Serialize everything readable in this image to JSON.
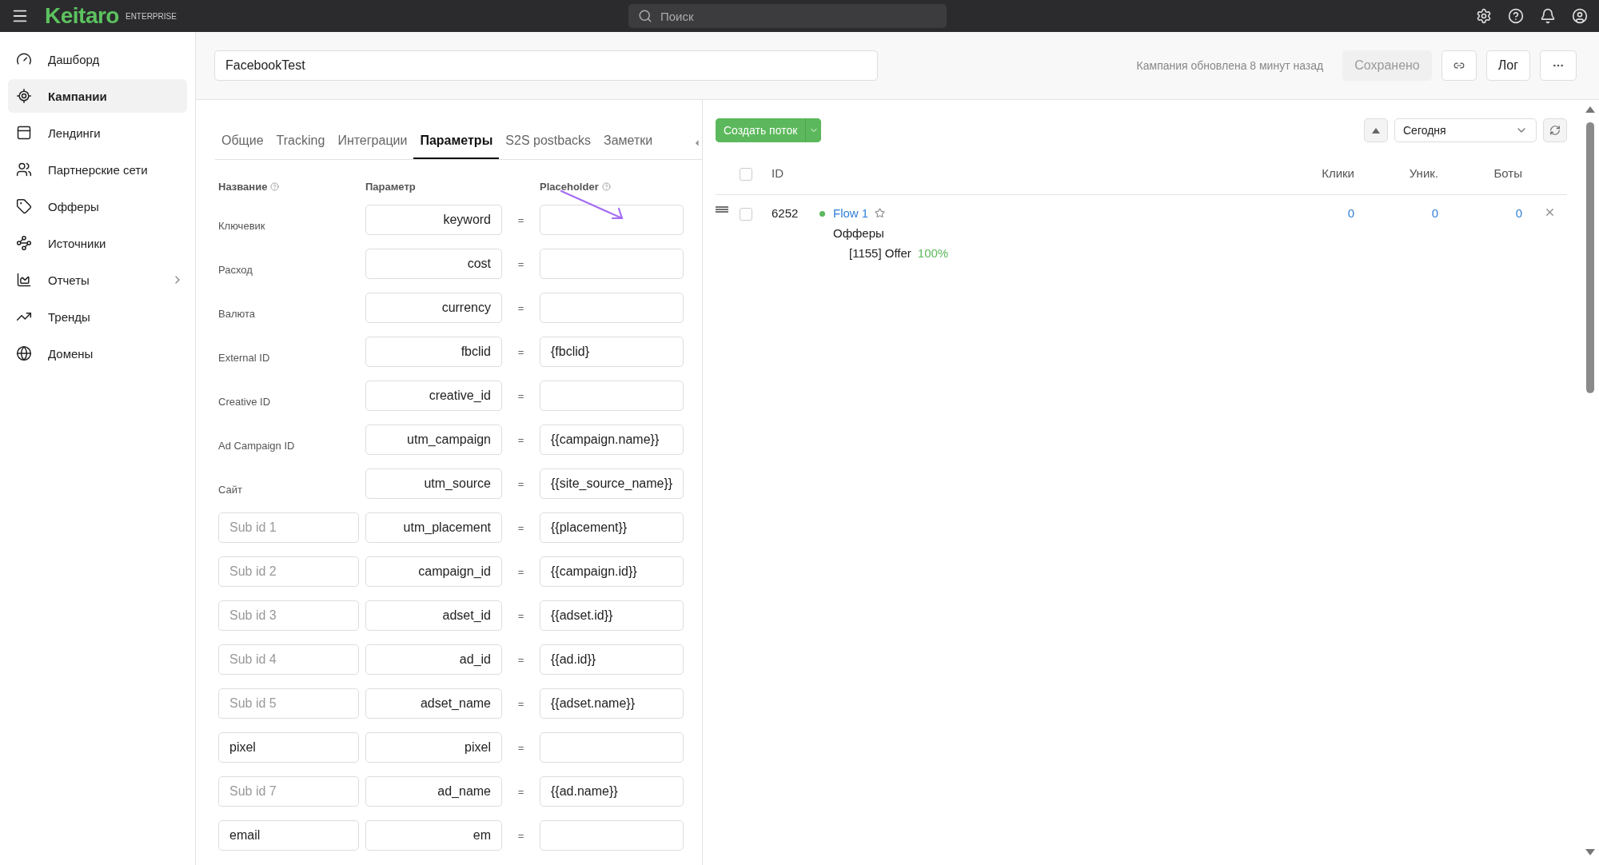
{
  "topbar": {
    "logo": "Keitaro",
    "edition": "ENTERPRISE",
    "search": {
      "placeholder": "Поиск"
    }
  },
  "sidebar": {
    "items": [
      {
        "label": "Дашборд",
        "selected": false,
        "has_submenu": false
      },
      {
        "label": "Кампании",
        "selected": true,
        "has_submenu": false
      },
      {
        "label": "Лендинги",
        "selected": false,
        "has_submenu": false
      },
      {
        "label": "Партнерские сети",
        "selected": false,
        "has_submenu": false
      },
      {
        "label": "Офферы",
        "selected": false,
        "has_submenu": false
      },
      {
        "label": "Источники",
        "selected": false,
        "has_submenu": false
      },
      {
        "label": "Отчеты",
        "selected": false,
        "has_submenu": true
      },
      {
        "label": "Тренды",
        "selected": false,
        "has_submenu": false
      },
      {
        "label": "Домены",
        "selected": false,
        "has_submenu": false
      }
    ]
  },
  "header": {
    "campaign_name": "FacebookTest",
    "updated": "Кампания обновлена 8 минут назад",
    "save_button": {
      "label": "Сохранено",
      "disabled": true
    },
    "log_button": "Лог"
  },
  "tabs": [
    {
      "label": "Общие",
      "selected": false
    },
    {
      "label": "Tracking",
      "selected": false
    },
    {
      "label": "Интеграции",
      "selected": false
    },
    {
      "label": "Параметры",
      "selected": true
    },
    {
      "label": "S2S postbacks",
      "selected": false
    },
    {
      "label": "Заметки",
      "selected": false
    }
  ],
  "parameters": {
    "columns": [
      "Название",
      "Параметр",
      "Placeholder"
    ],
    "rows": [
      {
        "kind": "label",
        "name": "Ключевик",
        "parameter": "keyword",
        "separator": "=",
        "value": ""
      },
      {
        "kind": "label",
        "name": "Расход",
        "parameter": "cost",
        "separator": "=",
        "value": ""
      },
      {
        "kind": "label",
        "name": "Валюта",
        "parameter": "currency",
        "separator": "=",
        "value": ""
      },
      {
        "kind": "label",
        "name": "External ID",
        "parameter": "fbclid",
        "separator": "=",
        "value": "{fbclid}"
      },
      {
        "kind": "label",
        "name": "Creative ID",
        "parameter": "creative_id",
        "separator": "=",
        "value": ""
      },
      {
        "kind": "label",
        "name": "Ad Campaign ID",
        "parameter": "utm_campaign",
        "separator": "=",
        "value": "{{campaign.name}}"
      },
      {
        "kind": "label",
        "name": "Сайт",
        "parameter": "utm_source",
        "separator": "=",
        "value": "{{site_source_name}}"
      },
      {
        "kind": "field",
        "name_hint": "Sub id 1",
        "parameter": "utm_placement",
        "separator": "=",
        "value": "{{placement}}"
      },
      {
        "kind": "field",
        "name_hint": "Sub id 2",
        "parameter": "campaign_id",
        "separator": "=",
        "value": "{{campaign.id}}"
      },
      {
        "kind": "field",
        "name_hint": "Sub id 3",
        "parameter": "adset_id",
        "separator": "=",
        "value": "{{adset.id}}"
      },
      {
        "kind": "field",
        "name_hint": "Sub id 4",
        "parameter": "ad_id",
        "separator": "=",
        "value": "{{ad.id}}"
      },
      {
        "kind": "field",
        "name_hint": "Sub id 5",
        "parameter": "adset_name",
        "separator": "=",
        "value": "{{adset.name}}"
      },
      {
        "kind": "field",
        "name": "pixel",
        "parameter": "pixel",
        "separator": "=",
        "value": ""
      },
      {
        "kind": "field",
        "name_hint": "Sub id 7",
        "parameter": "ad_name",
        "separator": "=",
        "value": "{{ad.name}}"
      },
      {
        "kind": "field",
        "name": "email",
        "parameter": "em",
        "separator": "=",
        "value": ""
      }
    ]
  },
  "flows": {
    "create_button": "Создать поток",
    "period": "Сегодня",
    "all_checked": false,
    "columns": [
      "ID",
      "Клики",
      "Уник.",
      "Боты"
    ],
    "rows": [
      {
        "id": "6252",
        "name": "Flow 1",
        "color": "#5cb85c",
        "checked": false,
        "section": "Офферы",
        "offer": "[1155] Offer",
        "share": "100%",
        "clicks": "0",
        "uniques": "0",
        "bots": "0"
      }
    ]
  }
}
